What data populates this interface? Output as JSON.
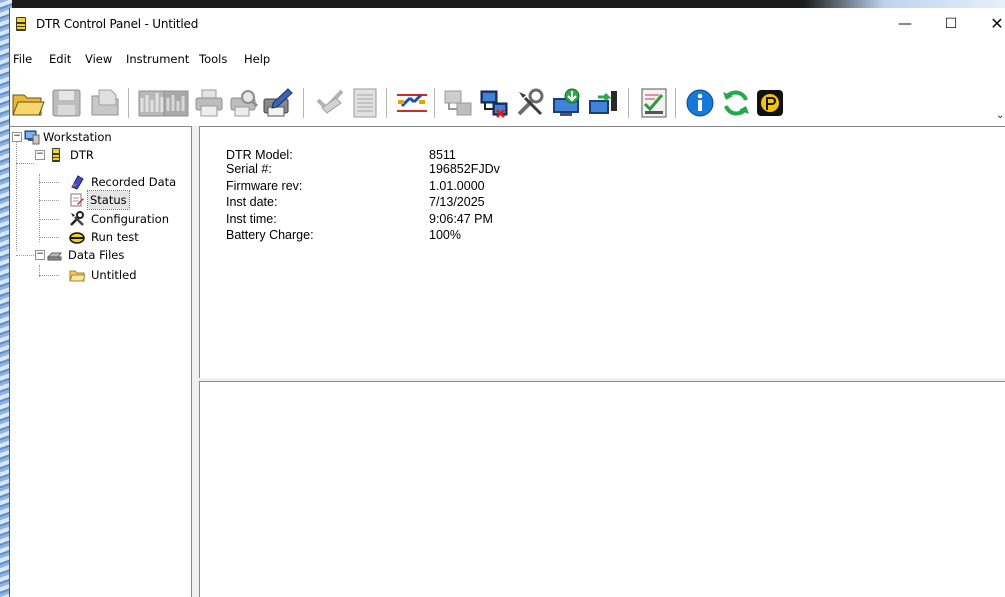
{
  "window": {
    "title": "DTR Control Panel - Untitled",
    "controls": {
      "minimize": "—",
      "maximize": "☐",
      "close": "✕"
    }
  },
  "menu": [
    "File",
    "Edit",
    "View",
    "Instrument",
    "Tools",
    "Help"
  ],
  "toolbar": {
    "buttons": [
      {
        "icon": "open-folder-icon",
        "enabled": true
      },
      {
        "icon": "save-icon",
        "enabled": false
      },
      {
        "icon": "open-file-icon",
        "enabled": false
      },
      {
        "icon": "chart-page-icon",
        "enabled": false
      },
      {
        "icon": "print-icon",
        "enabled": false
      },
      {
        "icon": "print-preview-icon",
        "enabled": false
      },
      {
        "icon": "print-setup-icon",
        "enabled": true
      },
      {
        "icon": "check-edit-icon",
        "enabled": false
      },
      {
        "icon": "report-icon",
        "enabled": false
      },
      {
        "icon": "test-leads-icon",
        "enabled": true
      },
      {
        "icon": "connect-icon",
        "enabled": false
      },
      {
        "icon": "disconnect-icon",
        "enabled": true
      },
      {
        "icon": "tools-icon",
        "enabled": true
      },
      {
        "icon": "download-icon",
        "enabled": true
      },
      {
        "icon": "upload-icon",
        "enabled": true
      },
      {
        "icon": "test-report-icon",
        "enabled": true
      },
      {
        "icon": "info-icon",
        "enabled": true
      },
      {
        "icon": "refresh-icon",
        "enabled": true
      },
      {
        "icon": "brand-logo-icon",
        "enabled": true
      }
    ],
    "overflow": "⌄"
  },
  "tree": {
    "root": "Workstation",
    "instrument": "DTR",
    "instrument_children": [
      "Recorded Data",
      "Status",
      "Configuration",
      "Run test"
    ],
    "data_files": "Data Files",
    "data_files_children": [
      "Untitled"
    ],
    "selected": "Status"
  },
  "status": {
    "labels": [
      "DTR Model:",
      "Serial #:",
      "Firmware rev:",
      "Inst date:",
      "Inst time:",
      "Battery Charge:"
    ],
    "values": [
      "8511",
      "196852FJDv",
      "1.01.0000",
      "7/13/2025",
      "9:06:47 PM",
      "100%"
    ]
  },
  "colors": {
    "accent_blue": "#1f5fb8",
    "folder_yellow": "#f2cf5b",
    "disabled_gray": "#a9a9a9",
    "info_blue": "#1479d9",
    "refresh_green": "#26a84a",
    "logo_yellow": "#f4c400"
  }
}
